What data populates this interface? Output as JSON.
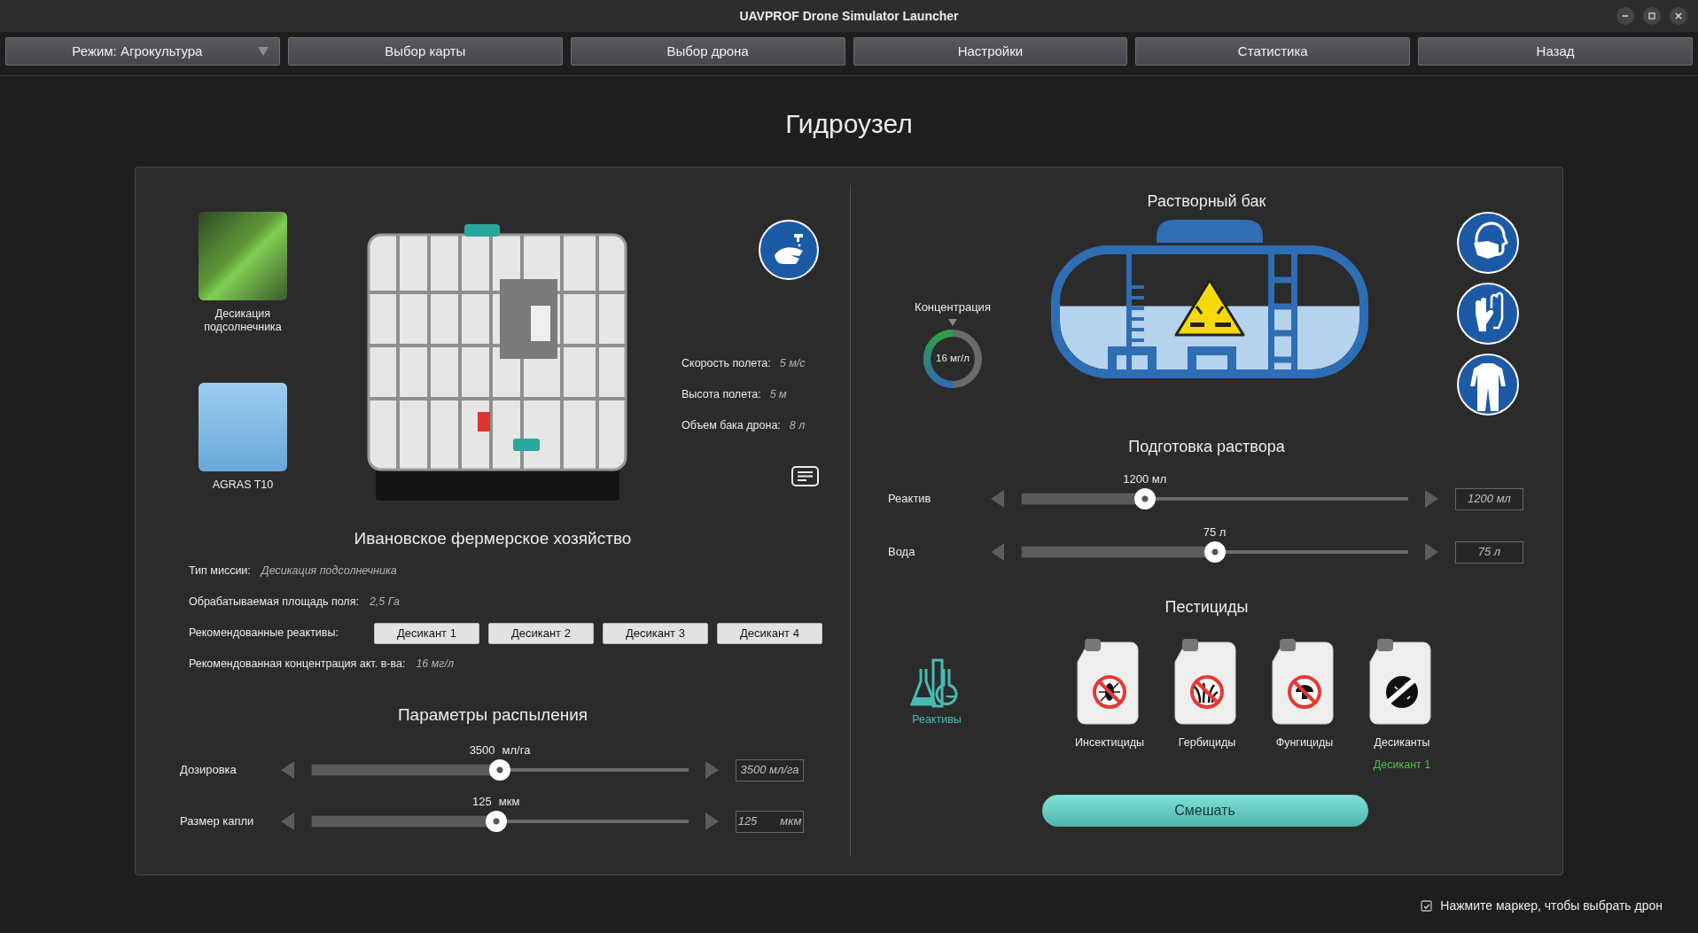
{
  "window": {
    "title": "UAVPROF Drone Simulator Launcher"
  },
  "menu": [
    {
      "label": "Режим: Агрокультура",
      "kind": "dropdown"
    },
    {
      "label": "Выбор карты",
      "kind": "button"
    },
    {
      "label": "Выбор дрона",
      "kind": "button"
    },
    {
      "label": "Настройки",
      "kind": "button"
    },
    {
      "label": "Статистика",
      "kind": "button"
    },
    {
      "label": "Назад",
      "kind": "button"
    }
  ],
  "page_title": "Гидроузел",
  "mission": {
    "label": "Десикация подсолнечника"
  },
  "drone": {
    "label": "AGRAS T10"
  },
  "flight_params": [
    {
      "label": "Скорость полета:",
      "value": "5 м/с"
    },
    {
      "label": "Высота полета:",
      "value": "5 м"
    },
    {
      "label": "Объем бака дрона:",
      "value": "8 л"
    }
  ],
  "farm_title": "Ивановское фермерское хозяйство",
  "mission_info": [
    {
      "kind": "text",
      "label": "Тип миссии:",
      "value": "Десикация подсолнечника"
    },
    {
      "kind": "text",
      "label": "Обрабатываемая площадь поля:",
      "value": "2,5 Га"
    },
    {
      "kind": "buttons",
      "label": "Рекомендованные реактивы:",
      "buttons": [
        "Десикант 1",
        "Десикант 2",
        "Десикант 3",
        "Десикант 4"
      ]
    },
    {
      "kind": "text",
      "label": "Рекомендованная концентрация акт. в-ва:",
      "value": "16 мг/л"
    }
  ],
  "spray_params": {
    "title": "Параметры распыления",
    "sliders": [
      {
        "label": "Дозировка",
        "value": "3500",
        "unit": "мл/га",
        "level": 0.5,
        "field": "3500 мл/га"
      },
      {
        "label": "Размер капли",
        "value": "125",
        "unit": "мкм",
        "level": 0.49,
        "field": "125",
        "field_unit": "мкм"
      }
    ]
  },
  "solution_tank": {
    "title": "Растворный бак",
    "concentration": {
      "label": "Концентрация",
      "reading": "16 мг/л",
      "level": 0.5
    }
  },
  "preparation": {
    "title": "Подготовка раствора",
    "sliders": [
      {
        "label": "Реактив",
        "value": "1200 мл",
        "level": 0.32,
        "field": "1200 мл"
      },
      {
        "label": "Вода",
        "value": "75 л",
        "level": 0.5,
        "field": "75 л"
      }
    ]
  },
  "pesticides": {
    "title": "Пестициды",
    "reagents_label": "Реактивы",
    "items": [
      {
        "kind": "insecticide",
        "label": "Инсектициды"
      },
      {
        "kind": "herbicide",
        "label": "Гербициды"
      },
      {
        "kind": "fungicide",
        "label": "Фунгициды"
      },
      {
        "kind": "desiccant",
        "label": "Десиканты",
        "selection": "Десикант 1"
      }
    ]
  },
  "mix_button": "Смешать",
  "footer": {
    "checked": true,
    "label": "Нажмите маркер, чтобы выбрать дрон"
  }
}
